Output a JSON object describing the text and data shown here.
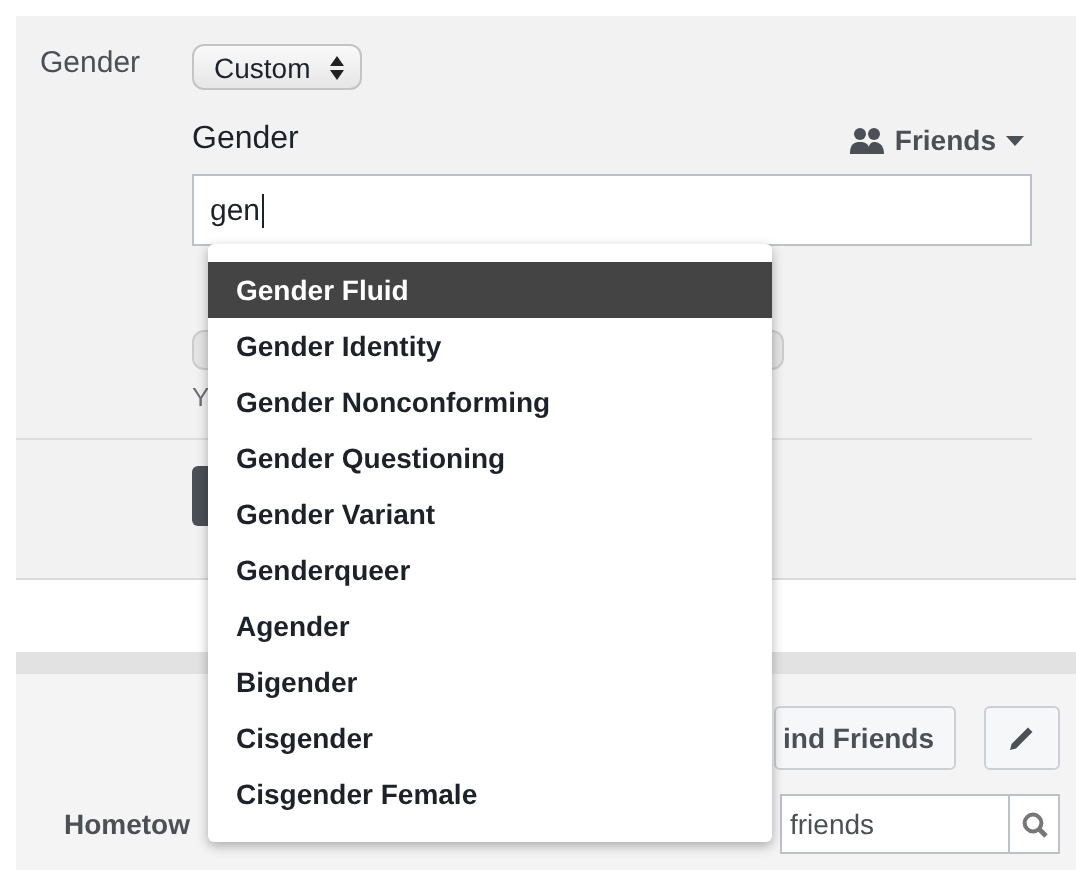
{
  "gender_row": {
    "label": "Gender",
    "select_value": "Custom"
  },
  "custom_gender": {
    "label": "Gender",
    "audience": "Friends",
    "input_value": "gen"
  },
  "suggestions": [
    {
      "label": "Gender Fluid",
      "selected": true
    },
    {
      "label": "Gender Identity",
      "selected": false
    },
    {
      "label": "Gender Nonconforming",
      "selected": false
    },
    {
      "label": "Gender Questioning",
      "selected": false
    },
    {
      "label": "Gender Variant",
      "selected": false
    },
    {
      "label": "Genderqueer",
      "selected": false
    },
    {
      "label": "Agender",
      "selected": false
    },
    {
      "label": "Bigender",
      "selected": false
    },
    {
      "label": "Cisgender",
      "selected": false
    },
    {
      "label": "Cisgender Female",
      "selected": false
    }
  ],
  "covered_form": {
    "note_fragment": "Y"
  },
  "toolbar": {
    "find_friends": "ind Friends"
  },
  "about_row": {
    "label_fragment": "Hometow",
    "search_placeholder": "friends"
  }
}
